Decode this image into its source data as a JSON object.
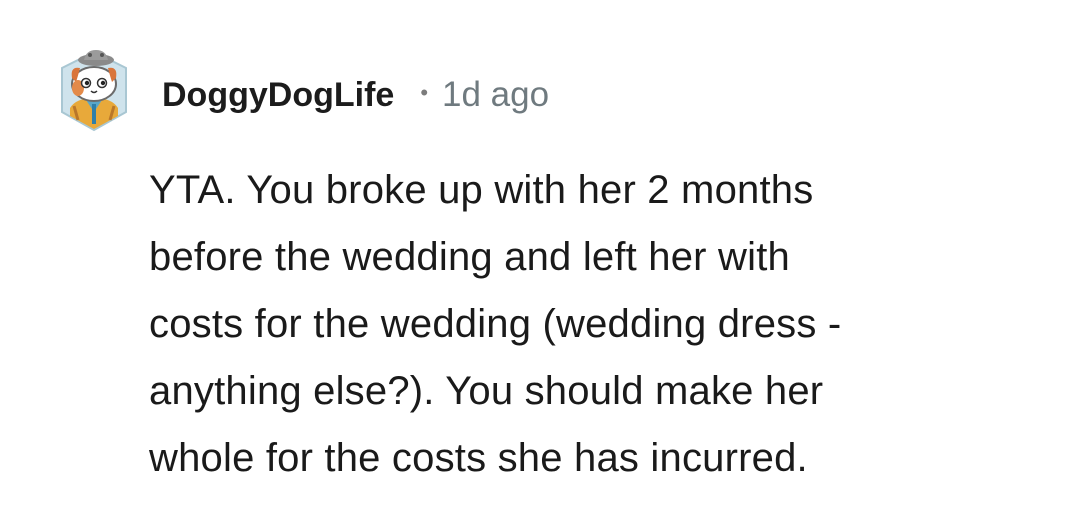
{
  "comment": {
    "username": "DoggyDogLife",
    "separator": "•",
    "timestamp": "1d ago",
    "body_lines": [
      "YTA. You broke up with her 2 months",
      "before the wedding and left her with",
      "costs for the wedding (wedding dress -",
      "anything else?). You should make her",
      "whole for the costs she has incurred."
    ],
    "avatar_icon": "snoo-avatar-icon"
  },
  "colors": {
    "username": "#1c1c1c",
    "timestamp": "#6f7a7f",
    "body": "#1a1a1a",
    "background": "#ffffff"
  }
}
